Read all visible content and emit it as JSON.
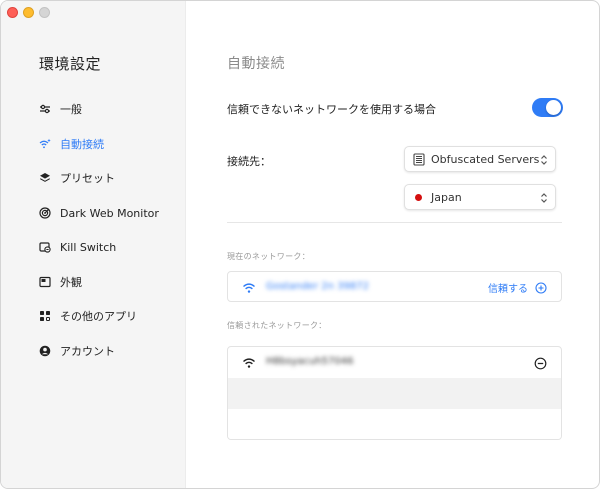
{
  "window": {
    "controls": {
      "close": "close",
      "minimize": "minimize",
      "maximize": "maximize"
    }
  },
  "sidebar": {
    "title": "環境設定",
    "items": [
      {
        "label": "一般",
        "icon": "sliders-icon"
      },
      {
        "label": "自動接続",
        "icon": "wifi-sparkle-icon",
        "active": true
      },
      {
        "label": "プリセット",
        "icon": "layers-icon"
      },
      {
        "label": "Dark Web Monitor",
        "icon": "radar-icon"
      },
      {
        "label": "Kill Switch",
        "icon": "kill-switch-icon"
      },
      {
        "label": "外観",
        "icon": "appearance-icon"
      },
      {
        "label": "その他のアプリ",
        "icon": "apps-grid-icon"
      },
      {
        "label": "アカウント",
        "icon": "account-icon"
      }
    ]
  },
  "main": {
    "title": "自動接続",
    "untrusted_label": "信頼できないネットワークを使用する場合",
    "untrusted_toggle": "on",
    "connect_to_label": "接続先：",
    "server_select": {
      "value": "Obfuscated Servers",
      "icon": "server-icon"
    },
    "country_select": {
      "value": "Japan",
      "icon": "red-dot-icon"
    },
    "current_network_label": "現在のネットワーク：",
    "current_network": {
      "name": "Gostander 2n 39872",
      "action": "信頼する"
    },
    "trusted_networks_label": "信頼されたネットワーク：",
    "trusted_networks": [
      {
        "name": "H8bsyacuh57046"
      }
    ]
  },
  "colors": {
    "accent": "#2f7cf6",
    "sidebar_bg": "#f5f5f5",
    "red_dot": "#d40f0f"
  }
}
